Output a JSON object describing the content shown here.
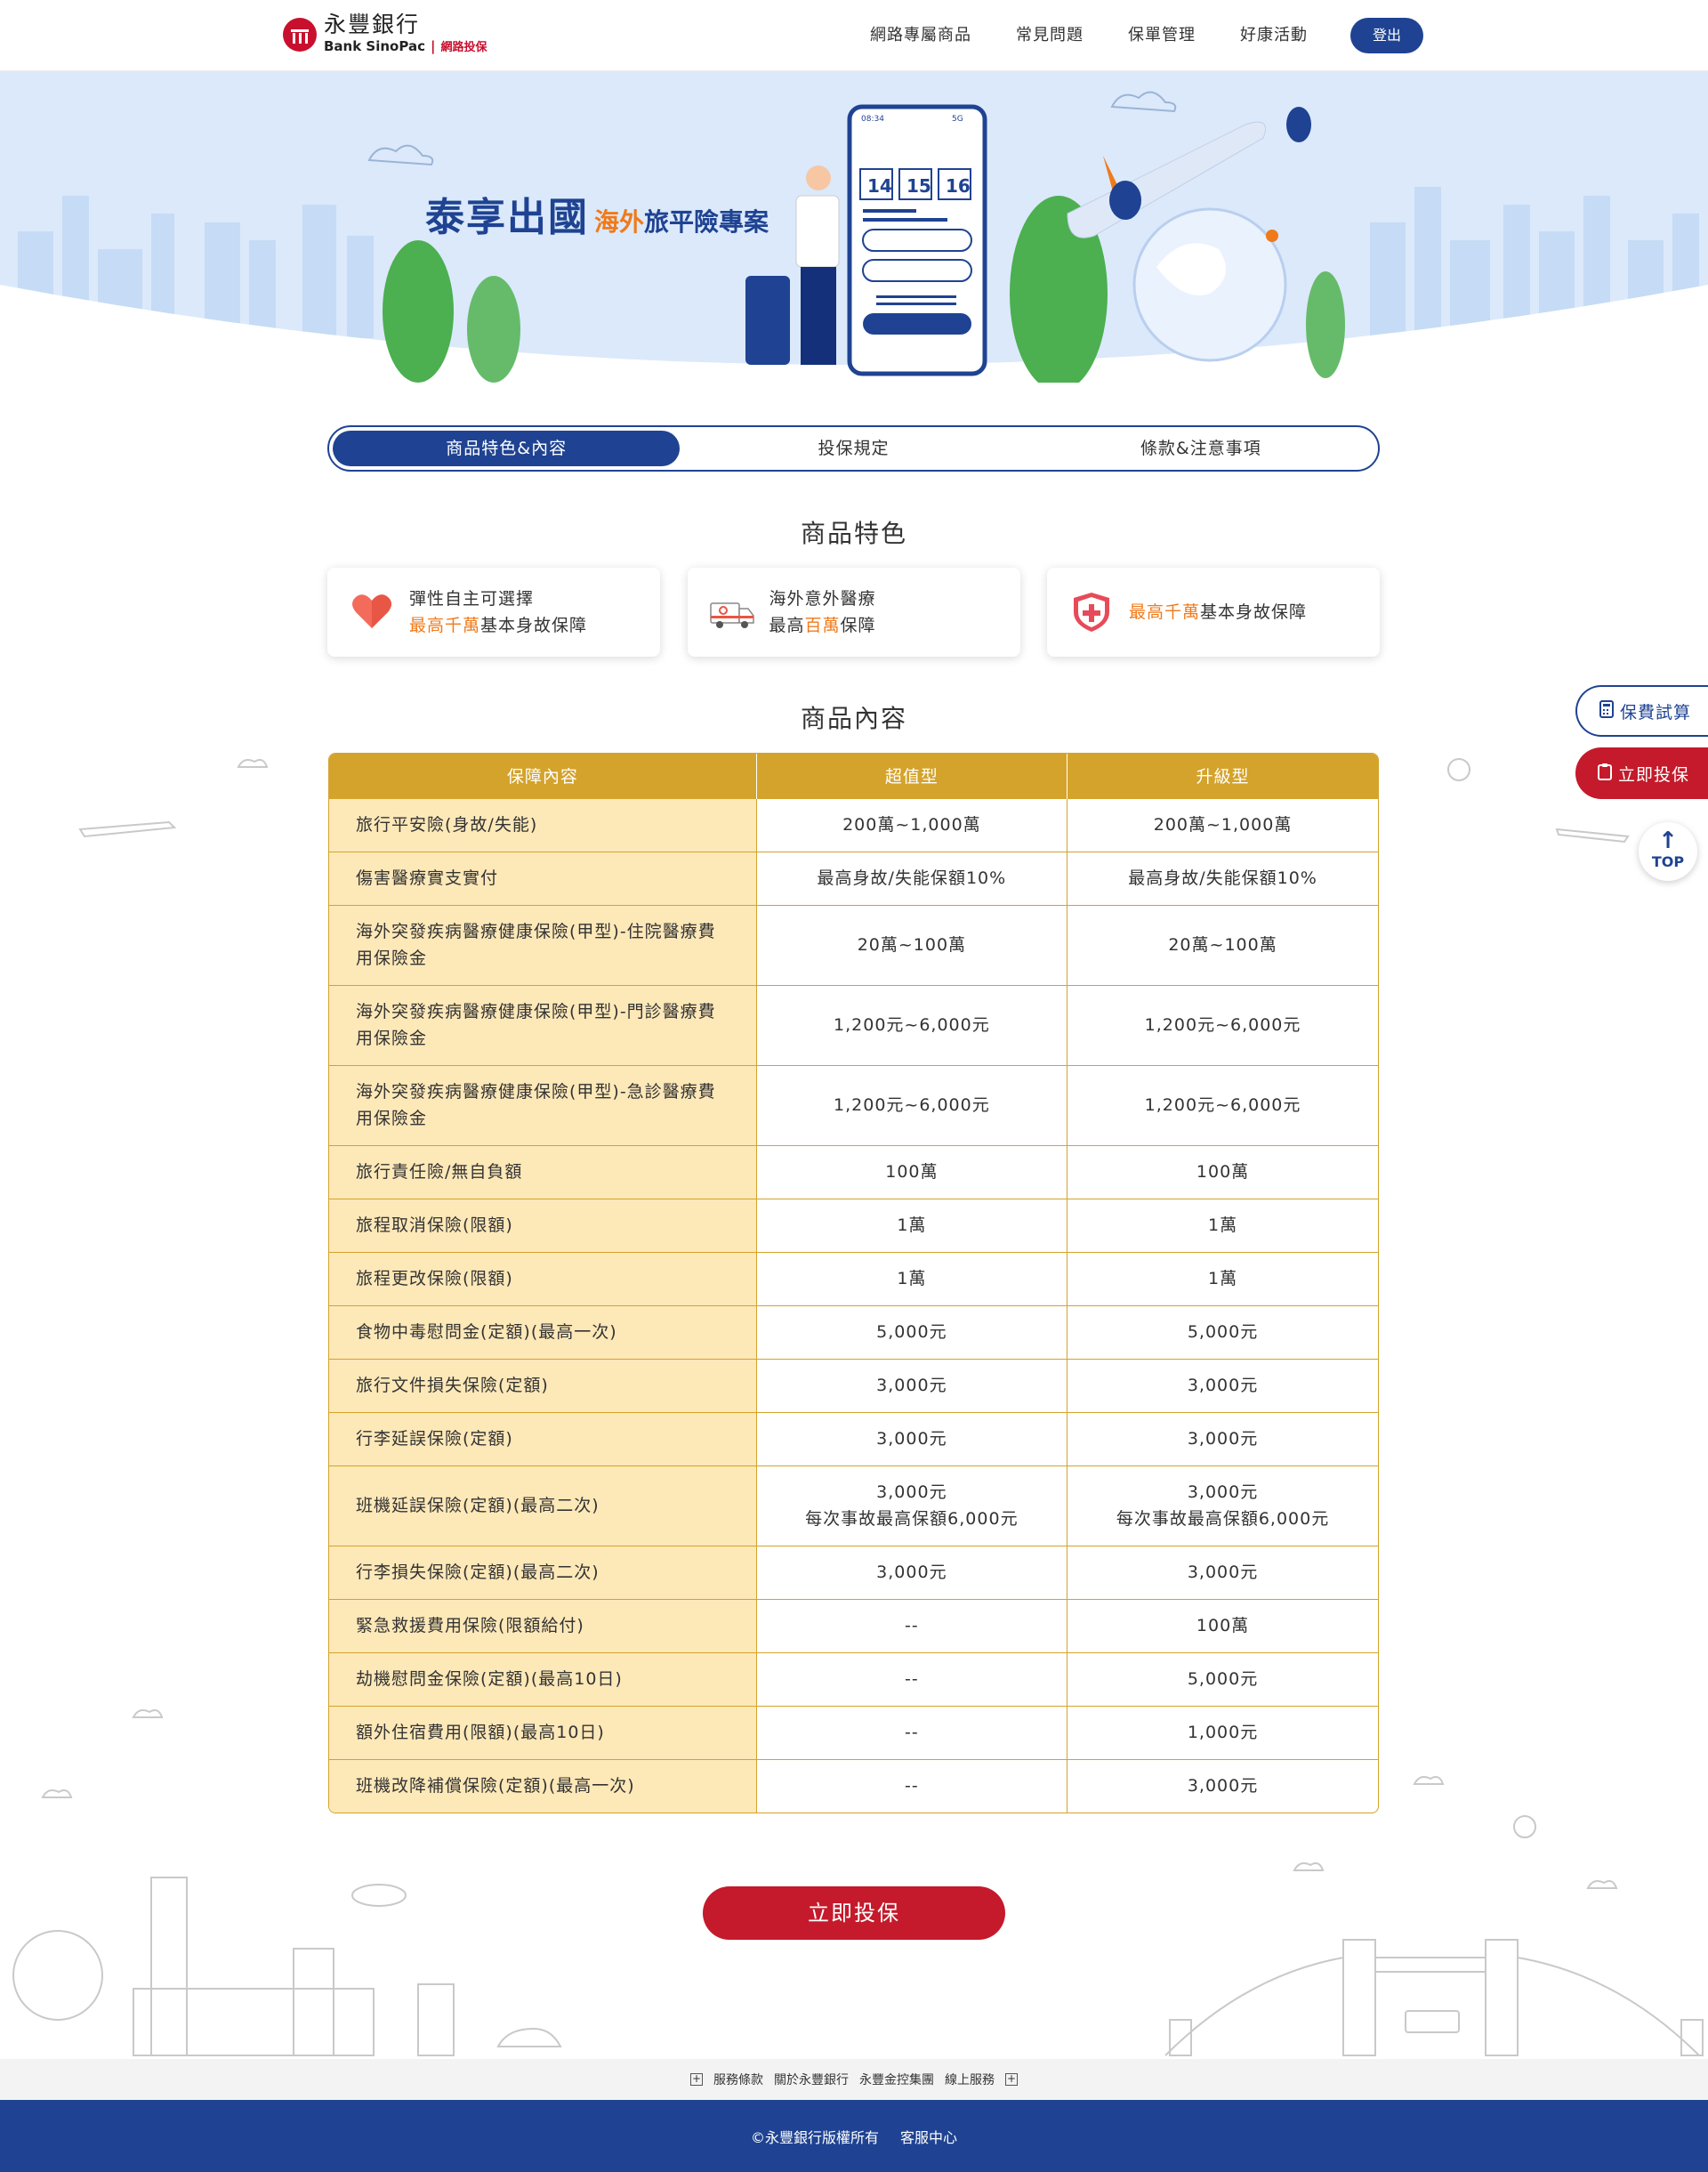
{
  "header": {
    "logo_cn": "永豐銀行",
    "logo_en": "Bank SinoPac",
    "logo_sep": "|",
    "logo_sub": "網路投保",
    "nav": [
      "網路專屬商品",
      "常見問題",
      "保單管理",
      "好康活動"
    ],
    "logout": "登出"
  },
  "banner": {
    "title_main": "泰享出國",
    "title_orange": "海外",
    "title_rest": "旅平險專案",
    "phone_time": "08:34",
    "phone_signal": "5G",
    "dates": [
      "14",
      "15",
      "16"
    ]
  },
  "tabs": [
    "商品特色&內容",
    "投保規定",
    "條款&注意事項"
  ],
  "features_title": "商品特色",
  "features": [
    {
      "icon": "heart-icon",
      "line1_pre": "彈性自主可選擇",
      "line2_hl": "最高千萬",
      "line2_rest": "基本身故保障"
    },
    {
      "icon": "ambulance-icon",
      "line1_pre": "海外意外醫療",
      "line2_a": "最高",
      "line2_hl": "百萬",
      "line2_rest": "保障"
    },
    {
      "icon": "shield-icon",
      "line_hl": "最高千萬",
      "line_rest": "基本身故保障"
    }
  ],
  "content_title": "商品內容",
  "table": {
    "headers": [
      "保障內容",
      "超值型",
      "升級型"
    ],
    "rows": [
      {
        "name": "旅行平安險(身故/失能)",
        "basic": "200萬~1,000萬",
        "upgrade": "200萬~1,000萬"
      },
      {
        "name": "傷害醫療實支實付",
        "basic": "最高身故/失能保額10%",
        "upgrade": "最高身故/失能保額10%"
      },
      {
        "name": "海外突發疾病醫療健康保險(甲型)-住院醫療費用保險金",
        "basic": "20萬~100萬",
        "upgrade": "20萬~100萬"
      },
      {
        "name": "海外突發疾病醫療健康保險(甲型)-門診醫療費用保險金",
        "basic": "1,200元~6,000元",
        "upgrade": "1,200元~6,000元"
      },
      {
        "name": "海外突發疾病醫療健康保險(甲型)-急診醫療費用保險金",
        "basic": "1,200元~6,000元",
        "upgrade": "1,200元~6,000元"
      },
      {
        "name": "旅行責任險/無自負額",
        "basic": "100萬",
        "upgrade": "100萬"
      },
      {
        "name": "旅程取消保險(限額)",
        "basic": "1萬",
        "upgrade": "1萬"
      },
      {
        "name": "旅程更改保險(限額)",
        "basic": "1萬",
        "upgrade": "1萬"
      },
      {
        "name": "食物中毒慰問金(定額)(最高一次)",
        "basic": "5,000元",
        "upgrade": "5,000元"
      },
      {
        "name": "旅行文件損失保險(定額)",
        "basic": "3,000元",
        "upgrade": "3,000元"
      },
      {
        "name": "行李延誤保險(定額)",
        "basic": "3,000元",
        "upgrade": "3,000元"
      },
      {
        "name": "班機延誤保險(定額)(最高二次)",
        "basic": "3,000元",
        "basic2": "每次事故最高保額6,000元",
        "upgrade": "3,000元",
        "upgrade2": "每次事故最高保額6,000元"
      },
      {
        "name": "行李損失保險(定額)(最高二次)",
        "basic": "3,000元",
        "upgrade": "3,000元"
      },
      {
        "name": "緊急救援費用保險(限額給付)",
        "basic": "--",
        "upgrade": "100萬"
      },
      {
        "name": "劫機慰問金保險(定額)(最高10日)",
        "basic": "--",
        "upgrade": "5,000元"
      },
      {
        "name": "額外住宿費用(限額)(最高10日)",
        "basic": "--",
        "upgrade": "1,000元"
      },
      {
        "name": "班機改降補償保險(定額)(最高一次)",
        "basic": "--",
        "upgrade": "3,000元"
      }
    ]
  },
  "cta": "立即投保",
  "side": {
    "calc": "保費試算",
    "apply": "立即投保",
    "top": "TOP"
  },
  "footer": {
    "links": [
      "服務條款",
      "關於永豐銀行",
      "永豐金控集團",
      "線上服務"
    ],
    "copyright": "©永豐銀行版權所有",
    "service": "客服中心"
  },
  "colors": {
    "primary": "#1f4392",
    "accent": "#c41a2b",
    "gold": "#d4a32b",
    "light_gold": "#fde8b8",
    "orange": "#f07a1a"
  }
}
